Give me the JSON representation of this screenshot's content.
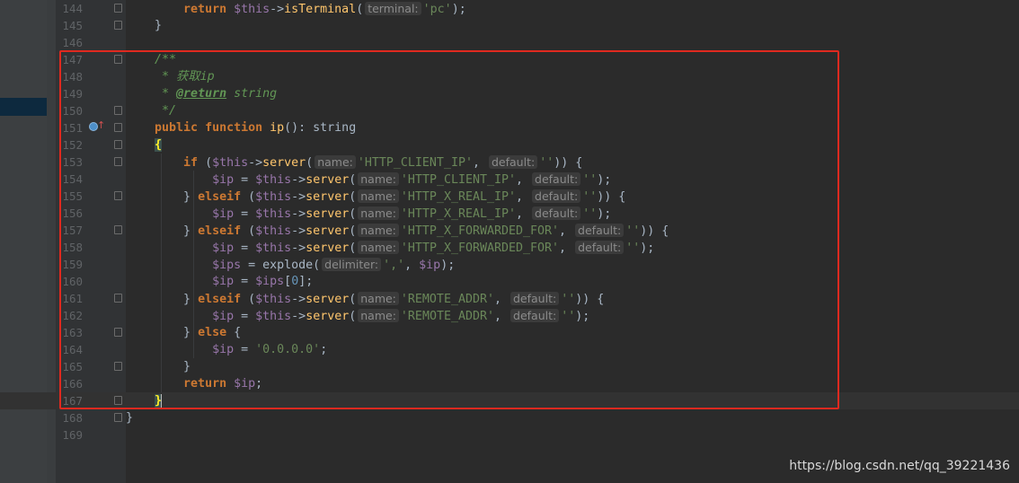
{
  "editor": {
    "lines": [
      {
        "num": "144",
        "segments": [
          [
            "",
            "        "
          ],
          [
            "kw",
            "return "
          ],
          [
            "var",
            "$this"
          ],
          [
            "",
            "->"
          ],
          [
            "fn",
            "isTerminal"
          ],
          [
            "",
            "("
          ],
          [
            "hint",
            "terminal:"
          ],
          [
            "str",
            "'pc'"
          ],
          [
            "",
            ");"
          ]
        ]
      },
      {
        "num": "145",
        "segments": [
          [
            "",
            "    }"
          ]
        ]
      },
      {
        "num": "146",
        "segments": []
      },
      {
        "num": "147",
        "segments": [
          [
            "",
            "    "
          ],
          [
            "doc",
            "/**"
          ]
        ]
      },
      {
        "num": "148",
        "segments": [
          [
            "",
            "     "
          ],
          [
            "doc",
            "* 获取ip"
          ]
        ]
      },
      {
        "num": "149",
        "segments": [
          [
            "",
            "     "
          ],
          [
            "doc",
            "* "
          ],
          [
            "doctag",
            "@return"
          ],
          [
            "doc",
            " string"
          ]
        ]
      },
      {
        "num": "150",
        "segments": [
          [
            "",
            "     "
          ],
          [
            "doc",
            "*/"
          ]
        ]
      },
      {
        "num": "151",
        "segments": [
          [
            "",
            "    "
          ],
          [
            "kw",
            "public function "
          ],
          [
            "fn",
            "ip"
          ],
          [
            "",
            "(): string"
          ]
        ]
      },
      {
        "num": "152",
        "segments": [
          [
            "",
            "    "
          ],
          [
            "brace-match",
            "{"
          ]
        ]
      },
      {
        "num": "153",
        "segments": [
          [
            "",
            "        "
          ],
          [
            "kw",
            "if "
          ],
          [
            "",
            "("
          ],
          [
            "var",
            "$this"
          ],
          [
            "",
            "->"
          ],
          [
            "fn",
            "server"
          ],
          [
            "",
            "("
          ],
          [
            "hint",
            "name:"
          ],
          [
            "str",
            "'HTTP_CLIENT_IP'"
          ],
          [
            "",
            ", "
          ],
          [
            "hint",
            "default:"
          ],
          [
            "str",
            "''"
          ],
          [
            "",
            ")) {"
          ]
        ]
      },
      {
        "num": "154",
        "segments": [
          [
            "",
            "            "
          ],
          [
            "var",
            "$ip"
          ],
          [
            "",
            " = "
          ],
          [
            "var",
            "$this"
          ],
          [
            "",
            "->"
          ],
          [
            "fn",
            "server"
          ],
          [
            "",
            "("
          ],
          [
            "hint",
            "name:"
          ],
          [
            "str",
            "'HTTP_CLIENT_IP'"
          ],
          [
            "",
            ", "
          ],
          [
            "hint",
            "default:"
          ],
          [
            "str",
            "''"
          ],
          [
            "",
            ");"
          ]
        ]
      },
      {
        "num": "155",
        "segments": [
          [
            "",
            "        } "
          ],
          [
            "kw",
            "elseif "
          ],
          [
            "",
            "("
          ],
          [
            "var",
            "$this"
          ],
          [
            "",
            "->"
          ],
          [
            "fn",
            "server"
          ],
          [
            "",
            "("
          ],
          [
            "hint",
            "name:"
          ],
          [
            "str",
            "'HTTP_X_REAL_IP'"
          ],
          [
            "",
            ", "
          ],
          [
            "hint",
            "default:"
          ],
          [
            "str",
            "''"
          ],
          [
            "",
            ")) {"
          ]
        ]
      },
      {
        "num": "156",
        "segments": [
          [
            "",
            "            "
          ],
          [
            "var",
            "$ip"
          ],
          [
            "",
            " = "
          ],
          [
            "var",
            "$this"
          ],
          [
            "",
            "->"
          ],
          [
            "fn",
            "server"
          ],
          [
            "",
            "("
          ],
          [
            "hint",
            "name:"
          ],
          [
            "str",
            "'HTTP_X_REAL_IP'"
          ],
          [
            "",
            ", "
          ],
          [
            "hint",
            "default:"
          ],
          [
            "str",
            "''"
          ],
          [
            "",
            ");"
          ]
        ]
      },
      {
        "num": "157",
        "segments": [
          [
            "",
            "        } "
          ],
          [
            "kw",
            "elseif "
          ],
          [
            "",
            "("
          ],
          [
            "var",
            "$this"
          ],
          [
            "",
            "->"
          ],
          [
            "fn",
            "server"
          ],
          [
            "",
            "("
          ],
          [
            "hint",
            "name:"
          ],
          [
            "str",
            "'HTTP_X_FORWARDED_FOR'"
          ],
          [
            "",
            ", "
          ],
          [
            "hint",
            "default:"
          ],
          [
            "str",
            "''"
          ],
          [
            "",
            ")) {"
          ]
        ]
      },
      {
        "num": "158",
        "segments": [
          [
            "",
            "            "
          ],
          [
            "var",
            "$ip"
          ],
          [
            "",
            " = "
          ],
          [
            "var",
            "$this"
          ],
          [
            "",
            "->"
          ],
          [
            "fn",
            "server"
          ],
          [
            "",
            "("
          ],
          [
            "hint",
            "name:"
          ],
          [
            "str",
            "'HTTP_X_FORWARDED_FOR'"
          ],
          [
            "",
            ", "
          ],
          [
            "hint",
            "default:"
          ],
          [
            "str",
            "''"
          ],
          [
            "",
            ");"
          ]
        ]
      },
      {
        "num": "159",
        "segments": [
          [
            "",
            "            "
          ],
          [
            "var",
            "$ips"
          ],
          [
            "",
            " = explode("
          ],
          [
            "hint",
            "delimiter:"
          ],
          [
            "str",
            "','"
          ],
          [
            "",
            ", "
          ],
          [
            "var",
            "$ip"
          ],
          [
            "",
            ");"
          ]
        ]
      },
      {
        "num": "160",
        "segments": [
          [
            "",
            "            "
          ],
          [
            "var",
            "$ip"
          ],
          [
            "",
            " = "
          ],
          [
            "var",
            "$ips"
          ],
          [
            "",
            "["
          ],
          [
            "num",
            "0"
          ],
          [
            "",
            "];"
          ]
        ]
      },
      {
        "num": "161",
        "segments": [
          [
            "",
            "        } "
          ],
          [
            "kw",
            "elseif "
          ],
          [
            "",
            "("
          ],
          [
            "var",
            "$this"
          ],
          [
            "",
            "->"
          ],
          [
            "fn",
            "server"
          ],
          [
            "",
            "("
          ],
          [
            "hint",
            "name:"
          ],
          [
            "str",
            "'REMOTE_ADDR'"
          ],
          [
            "",
            ", "
          ],
          [
            "hint",
            "default:"
          ],
          [
            "str",
            "''"
          ],
          [
            "",
            ")) {"
          ]
        ]
      },
      {
        "num": "162",
        "segments": [
          [
            "",
            "            "
          ],
          [
            "var",
            "$ip"
          ],
          [
            "",
            " = "
          ],
          [
            "var",
            "$this"
          ],
          [
            "",
            "->"
          ],
          [
            "fn",
            "server"
          ],
          [
            "",
            "("
          ],
          [
            "hint",
            "name:"
          ],
          [
            "str",
            "'REMOTE_ADDR'"
          ],
          [
            "",
            ", "
          ],
          [
            "hint",
            "default:"
          ],
          [
            "str",
            "''"
          ],
          [
            "",
            ");"
          ]
        ]
      },
      {
        "num": "163",
        "segments": [
          [
            "",
            "        } "
          ],
          [
            "kw",
            "else "
          ],
          [
            "",
            "{"
          ]
        ]
      },
      {
        "num": "164",
        "segments": [
          [
            "",
            "            "
          ],
          [
            "var",
            "$ip"
          ],
          [
            "",
            " = "
          ],
          [
            "str",
            "'0.0.0.0'"
          ],
          [
            "",
            ";"
          ]
        ]
      },
      {
        "num": "165",
        "segments": [
          [
            "",
            "        }"
          ]
        ]
      },
      {
        "num": "166",
        "segments": [
          [
            "",
            "        "
          ],
          [
            "kw",
            "return "
          ],
          [
            "var",
            "$ip"
          ],
          [
            "",
            ";"
          ]
        ]
      },
      {
        "num": "167",
        "segments": [
          [
            "",
            "    "
          ],
          [
            "brace-match",
            "}"
          ]
        ]
      },
      {
        "num": "168",
        "segments": [
          [
            "",
            "}"
          ]
        ]
      },
      {
        "num": "169",
        "segments": []
      }
    ],
    "fold_markers": [
      "144",
      "145",
      "147",
      "150",
      "151",
      "152",
      "153",
      "155",
      "157",
      "161",
      "163",
      "165",
      "167",
      "168"
    ],
    "current_line": "167",
    "gutter_icons": [
      {
        "line": "151",
        "name": "implements-icon"
      }
    ]
  },
  "colors": {
    "background": "#2b2b2b",
    "keyword": "#cc7832",
    "variable": "#9876aa",
    "function": "#ffc66d",
    "string": "#6a8759",
    "doc_comment": "#629755",
    "highlight_box": "#e0291f"
  },
  "watermark": "https://blog.csdn.net/qq_39221436"
}
